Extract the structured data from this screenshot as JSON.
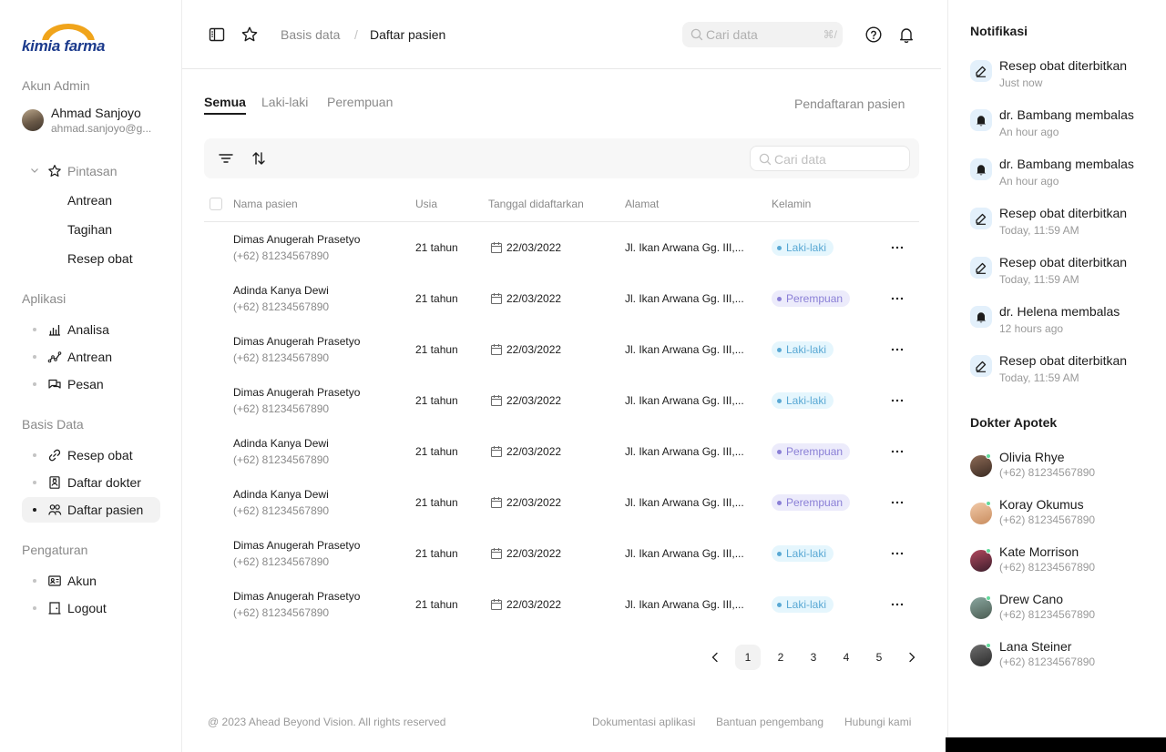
{
  "brand": {
    "logo_text": "kimia farma",
    "accent": "#f0a41b",
    "brand_color": "#1b3a8c"
  },
  "sidebar": {
    "account_title": "Akun Admin",
    "user": {
      "name": "Ahmad Sanjoyo",
      "email": "ahmad.sanjoyo@g..."
    },
    "shortcuts": {
      "label": "Pintasan",
      "icon": "star-icon",
      "items": [
        "Antrean",
        "Tagihan",
        "Resep obat"
      ]
    },
    "apps_title": "Aplikasi",
    "apps": [
      {
        "label": "Analisa",
        "icon": "chart-bar-icon"
      },
      {
        "label": "Antrean",
        "icon": "chart-line-icon"
      },
      {
        "label": "Pesan",
        "icon": "chat-icon"
      }
    ],
    "db_title": "Basis Data",
    "db": [
      {
        "label": "Resep obat",
        "icon": "link-icon"
      },
      {
        "label": "Daftar dokter",
        "icon": "id-card-icon"
      },
      {
        "label": "Daftar pasien",
        "icon": "users-icon"
      }
    ],
    "settings_title": "Pengaturan",
    "settings": [
      {
        "label": "Akun",
        "icon": "profile-icon"
      },
      {
        "label": "Logout",
        "icon": "door-icon"
      }
    ]
  },
  "header": {
    "breadcrumb_parent": "Basis data",
    "breadcrumb_sep": "/",
    "breadcrumb_current": "Daftar pasien",
    "search_placeholder": "Cari data",
    "search_shortcut": "⌘/"
  },
  "tabs": [
    "Semua",
    "Laki-laki",
    "Perempuan"
  ],
  "register_link": "Pendaftaran pasien",
  "table": {
    "search_placeholder": "Cari data",
    "columns": [
      "Nama pasien",
      "Usia",
      "Tanggal didaftarkan",
      "Alamat",
      "Kelamin"
    ],
    "rows": [
      {
        "name": "Dimas Anugerah Prasetyo",
        "phone": "(+62) 81234567890",
        "age": "21 tahun",
        "date": "22/03/2022",
        "address": "Jl. Ikan Arwana Gg. III,...",
        "gender": "Laki-laki",
        "g": "m"
      },
      {
        "name": "Adinda Kanya Dewi",
        "phone": "(+62) 81234567890",
        "age": "21 tahun",
        "date": "22/03/2022",
        "address": "Jl. Ikan Arwana Gg. III,...",
        "gender": "Perempuan",
        "g": "f"
      },
      {
        "name": "Dimas Anugerah Prasetyo",
        "phone": "(+62) 81234567890",
        "age": "21 tahun",
        "date": "22/03/2022",
        "address": "Jl. Ikan Arwana Gg. III,...",
        "gender": "Laki-laki",
        "g": "m"
      },
      {
        "name": "Dimas Anugerah Prasetyo",
        "phone": "(+62) 81234567890",
        "age": "21 tahun",
        "date": "22/03/2022",
        "address": "Jl. Ikan Arwana Gg. III,...",
        "gender": "Laki-laki",
        "g": "m"
      },
      {
        "name": "Adinda Kanya Dewi",
        "phone": "(+62) 81234567890",
        "age": "21 tahun",
        "date": "22/03/2022",
        "address": "Jl. Ikan Arwana Gg. III,...",
        "gender": "Perempuan",
        "g": "f"
      },
      {
        "name": "Adinda Kanya Dewi",
        "phone": "(+62) 81234567890",
        "age": "21 tahun",
        "date": "22/03/2022",
        "address": "Jl. Ikan Arwana Gg. III,...",
        "gender": "Perempuan",
        "g": "f"
      },
      {
        "name": "Dimas Anugerah Prasetyo",
        "phone": "(+62) 81234567890",
        "age": "21 tahun",
        "date": "22/03/2022",
        "address": "Jl. Ikan Arwana Gg. III,...",
        "gender": "Laki-laki",
        "g": "m"
      },
      {
        "name": "Dimas Anugerah Prasetyo",
        "phone": "(+62) 81234567890",
        "age": "21 tahun",
        "date": "22/03/2022",
        "address": "Jl. Ikan Arwana Gg. III,...",
        "gender": "Laki-laki",
        "g": "m"
      }
    ]
  },
  "pagination": {
    "pages": [
      "1",
      "2",
      "3",
      "4",
      "5"
    ],
    "current": "1"
  },
  "footer": {
    "copyright": "@ 2023 Ahead Beyond Vision. All rights reserved",
    "links": [
      "Dokumentasi aplikasi",
      "Bantuan pengembang",
      "Hubungi kami"
    ]
  },
  "notifications": {
    "title": "Notifikasi",
    "items": [
      {
        "text": "Resep obat diterbitkan",
        "time": "Just now",
        "icon": "edit-icon"
      },
      {
        "text": "dr. Bambang membalas",
        "time": "An hour ago",
        "icon": "bell-icon"
      },
      {
        "text": "dr. Bambang membalas",
        "time": "An hour ago",
        "icon": "bell-icon"
      },
      {
        "text": "Resep obat diterbitkan",
        "time": "Today, 11:59 AM",
        "icon": "edit-icon"
      },
      {
        "text": "Resep obat diterbitkan",
        "time": "Today, 11:59 AM",
        "icon": "edit-icon"
      },
      {
        "text": "dr. Helena membalas",
        "time": "12 hours ago",
        "icon": "bell-icon"
      },
      {
        "text": "Resep obat diterbitkan",
        "time": "Today, 11:59 AM",
        "icon": "edit-icon"
      }
    ]
  },
  "doctors": {
    "title": "Dokter Apotek",
    "items": [
      {
        "name": "Olivia Rhye",
        "phone": "(+62) 81234567890"
      },
      {
        "name": "Koray Okumus",
        "phone": "(+62) 81234567890"
      },
      {
        "name": "Kate Morrison",
        "phone": "(+62) 81234567890"
      },
      {
        "name": "Drew Cano",
        "phone": "(+62) 81234567890"
      },
      {
        "name": "Lana Steiner",
        "phone": "(+62) 81234567890"
      }
    ]
  }
}
